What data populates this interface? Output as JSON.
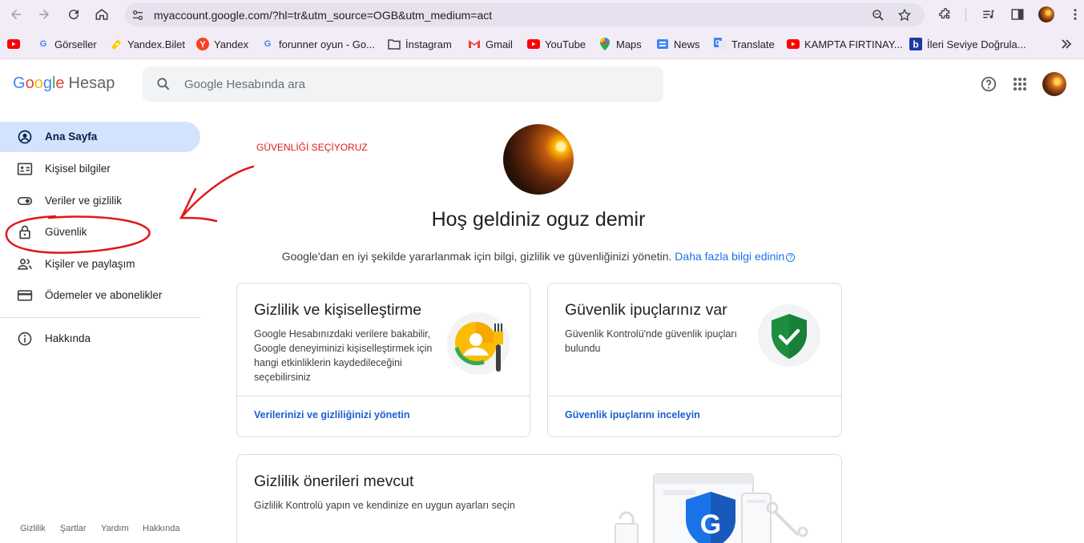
{
  "browser": {
    "url": "myaccount.google.com/?hl=tr&utm_source=OGB&utm_medium=act",
    "bookmarks": [
      {
        "label": "",
        "icon": "youtube-icon"
      },
      {
        "label": "Görseller",
        "icon": "google-icon"
      },
      {
        "label": "Yandex.Bilet",
        "icon": "yandex-bilet-icon"
      },
      {
        "label": "Yandex",
        "icon": "yandex-icon"
      },
      {
        "label": "forunner oyun - Go...",
        "icon": "google-icon"
      },
      {
        "label": "İnstagram",
        "icon": "folder-icon"
      },
      {
        "label": "Gmail",
        "icon": "gmail-icon"
      },
      {
        "label": "YouTube",
        "icon": "youtube-icon"
      },
      {
        "label": "Maps",
        "icon": "maps-icon"
      },
      {
        "label": "News",
        "icon": "news-icon"
      },
      {
        "label": "Translate",
        "icon": "translate-icon"
      },
      {
        "label": "KAMPTA FIRTINAY...",
        "icon": "youtube-icon"
      },
      {
        "label": "İleri Seviye Doğrula...",
        "icon": "bookmark-b-icon"
      }
    ]
  },
  "header": {
    "logo_google": [
      "G",
      "o",
      "o",
      "g",
      "l",
      "e"
    ],
    "logo_product": "Hesap",
    "search_placeholder": "Google Hesabında ara"
  },
  "sidebar": {
    "items": [
      {
        "label": "Ana Sayfa",
        "icon": "account-circle-icon",
        "active": true
      },
      {
        "label": "Kişisel bilgiler",
        "icon": "id-card-icon"
      },
      {
        "label": "Veriler ve gizlilik",
        "icon": "toggle-icon"
      },
      {
        "label": "Güvenlik",
        "icon": "lock-icon"
      },
      {
        "label": "Kişiler ve paylaşım",
        "icon": "people-icon"
      },
      {
        "label": "Ödemeler ve abonelikler",
        "icon": "credit-card-icon"
      },
      {
        "label": "Hakkında",
        "icon": "info-icon"
      }
    ],
    "footer": [
      "Gizlilik",
      "Şartlar",
      "Yardım",
      "Hakkında"
    ]
  },
  "annotation": {
    "text": "GÜVENLİĞİ SEÇİYORUZ",
    "color": "#e01919"
  },
  "main": {
    "welcome": "Hoş geldiniz oguz demir",
    "subtitle": "Google'dan en iyi şekilde yararlanmak için bilgi, gizlilik ve güvenliğinizi yönetin.",
    "subtitle_link": "Daha fazla bilgi edinin",
    "cards": [
      {
        "title": "Gizlilik ve kişiselleştirme",
        "desc": "Google Hesabınızdaki verilere bakabilir, Google deneyiminizi kişiselleştirmek için hangi etkinliklerin kaydedileceğini seçebilirsiniz",
        "link": "Verilerinizi ve gizliliğinizi yönetin"
      },
      {
        "title": "Güvenlik ipuçlarınız var",
        "desc": "Güvenlik Kontrolü'nde güvenlik ipuçları bulundu",
        "link": "Güvenlik ipuçlarını inceleyin"
      },
      {
        "title": "Gizlilik önerileri mevcut",
        "desc": "Gizlilik Kontrolü yapın ve kendinize en uygun ayarları seçin"
      }
    ]
  },
  "colors": {
    "active_nav_bg": "#d3e3fd",
    "link": "#1a73e8",
    "shield_green": "#1e8e3e",
    "shield_blue": "#1a73e8"
  }
}
